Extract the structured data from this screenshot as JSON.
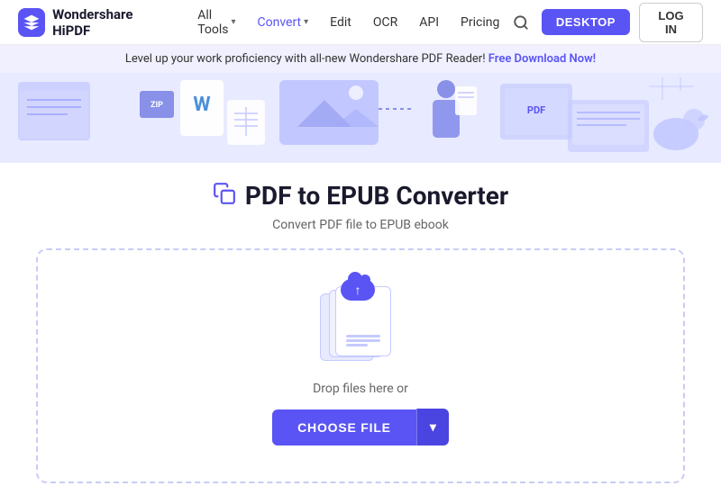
{
  "logo": {
    "text": "Wondershare HiPDF"
  },
  "navbar": {
    "items": [
      {
        "label": "All Tools",
        "hasDropdown": true
      },
      {
        "label": "Convert",
        "hasDropdown": true
      },
      {
        "label": "Edit",
        "hasDropdown": false
      },
      {
        "label": "OCR",
        "hasDropdown": false
      },
      {
        "label": "API",
        "hasDropdown": false
      },
      {
        "label": "Pricing",
        "hasDropdown": false
      }
    ],
    "desktop_button": "DESKTOP",
    "login_button": "LOG IN"
  },
  "banner": {
    "text": "Level up your work proficiency with all-new Wondershare PDF Reader!",
    "link_text": "Free Download Now!"
  },
  "page": {
    "title": "PDF to EPUB Converter",
    "subtitle": "Convert PDF file to EPUB ebook"
  },
  "dropzone": {
    "drop_text": "Drop files here or",
    "choose_button": "CHOOSE FILE"
  }
}
